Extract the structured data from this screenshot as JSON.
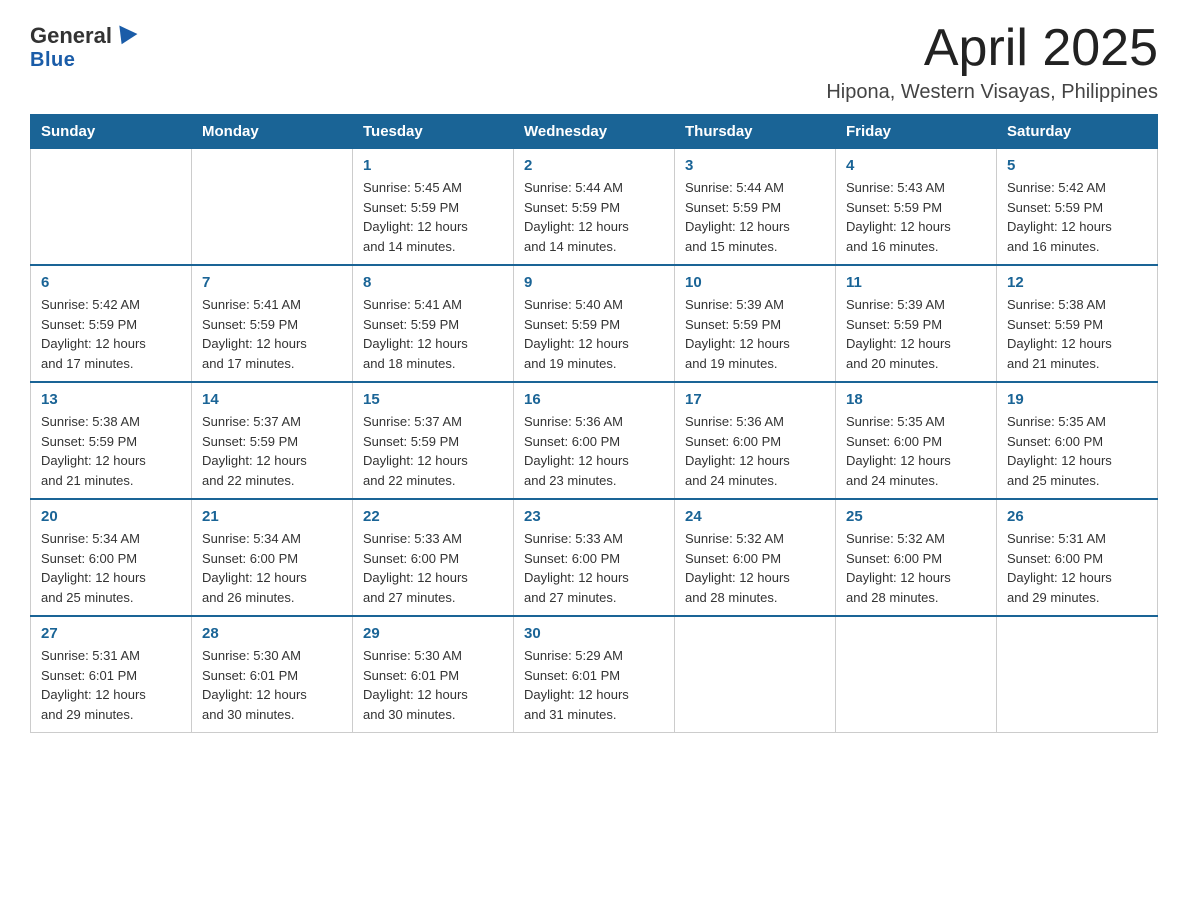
{
  "header": {
    "logo_general": "General",
    "logo_blue": "Blue",
    "title": "April 2025",
    "subtitle": "Hipona, Western Visayas, Philippines"
  },
  "weekdays": [
    "Sunday",
    "Monday",
    "Tuesday",
    "Wednesday",
    "Thursday",
    "Friday",
    "Saturday"
  ],
  "weeks": [
    [
      {
        "day": "",
        "info": ""
      },
      {
        "day": "",
        "info": ""
      },
      {
        "day": "1",
        "info": "Sunrise: 5:45 AM\nSunset: 5:59 PM\nDaylight: 12 hours\nand 14 minutes."
      },
      {
        "day": "2",
        "info": "Sunrise: 5:44 AM\nSunset: 5:59 PM\nDaylight: 12 hours\nand 14 minutes."
      },
      {
        "day": "3",
        "info": "Sunrise: 5:44 AM\nSunset: 5:59 PM\nDaylight: 12 hours\nand 15 minutes."
      },
      {
        "day": "4",
        "info": "Sunrise: 5:43 AM\nSunset: 5:59 PM\nDaylight: 12 hours\nand 16 minutes."
      },
      {
        "day": "5",
        "info": "Sunrise: 5:42 AM\nSunset: 5:59 PM\nDaylight: 12 hours\nand 16 minutes."
      }
    ],
    [
      {
        "day": "6",
        "info": "Sunrise: 5:42 AM\nSunset: 5:59 PM\nDaylight: 12 hours\nand 17 minutes."
      },
      {
        "day": "7",
        "info": "Sunrise: 5:41 AM\nSunset: 5:59 PM\nDaylight: 12 hours\nand 17 minutes."
      },
      {
        "day": "8",
        "info": "Sunrise: 5:41 AM\nSunset: 5:59 PM\nDaylight: 12 hours\nand 18 minutes."
      },
      {
        "day": "9",
        "info": "Sunrise: 5:40 AM\nSunset: 5:59 PM\nDaylight: 12 hours\nand 19 minutes."
      },
      {
        "day": "10",
        "info": "Sunrise: 5:39 AM\nSunset: 5:59 PM\nDaylight: 12 hours\nand 19 minutes."
      },
      {
        "day": "11",
        "info": "Sunrise: 5:39 AM\nSunset: 5:59 PM\nDaylight: 12 hours\nand 20 minutes."
      },
      {
        "day": "12",
        "info": "Sunrise: 5:38 AM\nSunset: 5:59 PM\nDaylight: 12 hours\nand 21 minutes."
      }
    ],
    [
      {
        "day": "13",
        "info": "Sunrise: 5:38 AM\nSunset: 5:59 PM\nDaylight: 12 hours\nand 21 minutes."
      },
      {
        "day": "14",
        "info": "Sunrise: 5:37 AM\nSunset: 5:59 PM\nDaylight: 12 hours\nand 22 minutes."
      },
      {
        "day": "15",
        "info": "Sunrise: 5:37 AM\nSunset: 5:59 PM\nDaylight: 12 hours\nand 22 minutes."
      },
      {
        "day": "16",
        "info": "Sunrise: 5:36 AM\nSunset: 6:00 PM\nDaylight: 12 hours\nand 23 minutes."
      },
      {
        "day": "17",
        "info": "Sunrise: 5:36 AM\nSunset: 6:00 PM\nDaylight: 12 hours\nand 24 minutes."
      },
      {
        "day": "18",
        "info": "Sunrise: 5:35 AM\nSunset: 6:00 PM\nDaylight: 12 hours\nand 24 minutes."
      },
      {
        "day": "19",
        "info": "Sunrise: 5:35 AM\nSunset: 6:00 PM\nDaylight: 12 hours\nand 25 minutes."
      }
    ],
    [
      {
        "day": "20",
        "info": "Sunrise: 5:34 AM\nSunset: 6:00 PM\nDaylight: 12 hours\nand 25 minutes."
      },
      {
        "day": "21",
        "info": "Sunrise: 5:34 AM\nSunset: 6:00 PM\nDaylight: 12 hours\nand 26 minutes."
      },
      {
        "day": "22",
        "info": "Sunrise: 5:33 AM\nSunset: 6:00 PM\nDaylight: 12 hours\nand 27 minutes."
      },
      {
        "day": "23",
        "info": "Sunrise: 5:33 AM\nSunset: 6:00 PM\nDaylight: 12 hours\nand 27 minutes."
      },
      {
        "day": "24",
        "info": "Sunrise: 5:32 AM\nSunset: 6:00 PM\nDaylight: 12 hours\nand 28 minutes."
      },
      {
        "day": "25",
        "info": "Sunrise: 5:32 AM\nSunset: 6:00 PM\nDaylight: 12 hours\nand 28 minutes."
      },
      {
        "day": "26",
        "info": "Sunrise: 5:31 AM\nSunset: 6:00 PM\nDaylight: 12 hours\nand 29 minutes."
      }
    ],
    [
      {
        "day": "27",
        "info": "Sunrise: 5:31 AM\nSunset: 6:01 PM\nDaylight: 12 hours\nand 29 minutes."
      },
      {
        "day": "28",
        "info": "Sunrise: 5:30 AM\nSunset: 6:01 PM\nDaylight: 12 hours\nand 30 minutes."
      },
      {
        "day": "29",
        "info": "Sunrise: 5:30 AM\nSunset: 6:01 PM\nDaylight: 12 hours\nand 30 minutes."
      },
      {
        "day": "30",
        "info": "Sunrise: 5:29 AM\nSunset: 6:01 PM\nDaylight: 12 hours\nand 31 minutes."
      },
      {
        "day": "",
        "info": ""
      },
      {
        "day": "",
        "info": ""
      },
      {
        "day": "",
        "info": ""
      }
    ]
  ]
}
